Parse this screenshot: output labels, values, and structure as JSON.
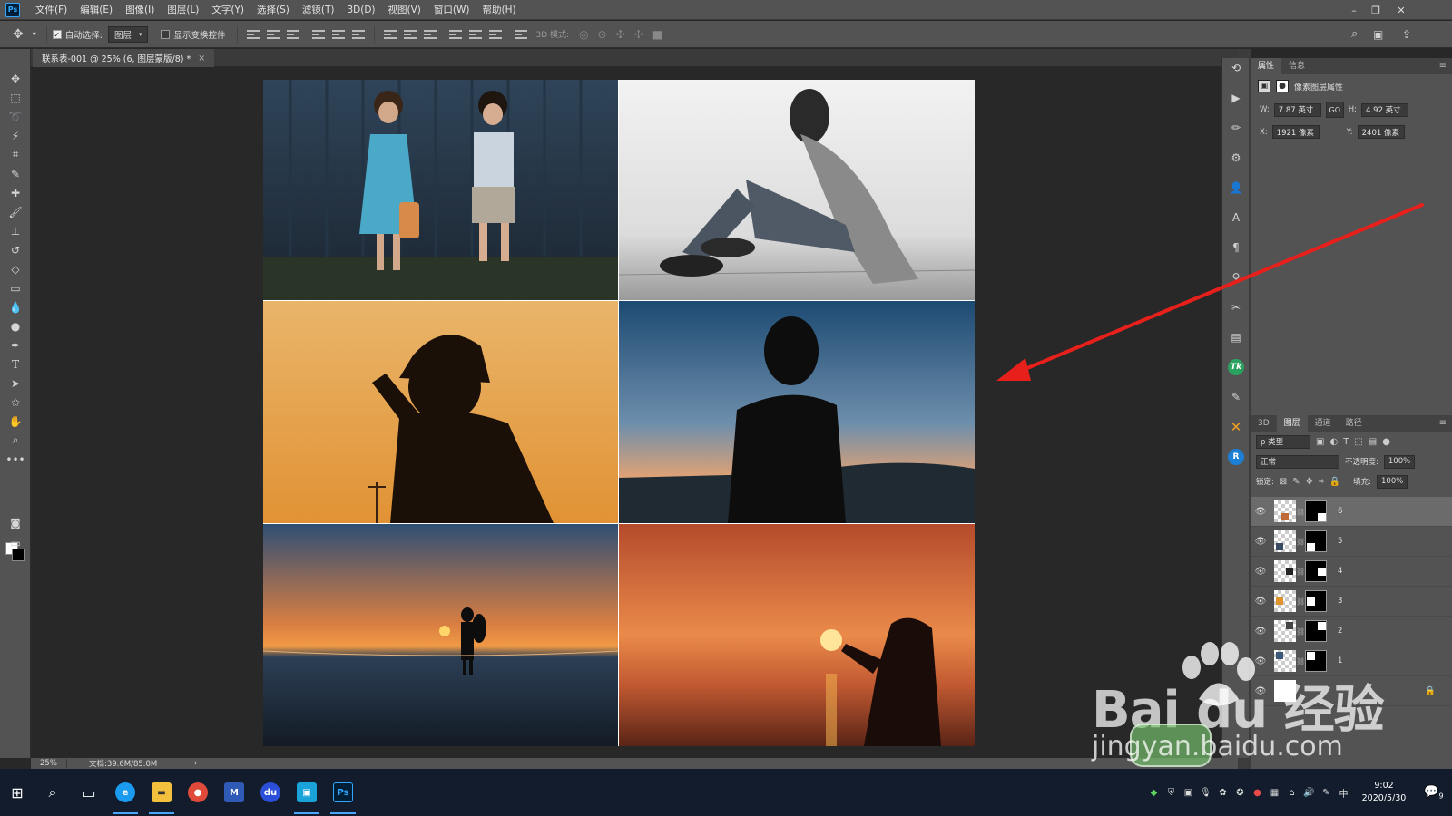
{
  "menubar": {
    "logo": "Ps",
    "items": [
      "文件(F)",
      "编辑(E)",
      "图像(I)",
      "图层(L)",
      "文字(Y)",
      "选择(S)",
      "滤镜(T)",
      "3D(D)",
      "视图(V)",
      "窗口(W)",
      "帮助(H)"
    ]
  },
  "optionsbar": {
    "auto_select_label": "自动选择:",
    "auto_select_value": "图层",
    "transform_label": "显示变换控件",
    "mode_3d_label": "3D 模式:"
  },
  "document_tab": {
    "title": "联系表-001 @ 25% (6, 图层蒙版/8) *",
    "close": "×"
  },
  "statusbar": {
    "zoom": "25%",
    "doc_info": "文档:39.6M/85.0M",
    "arrow": "›"
  },
  "properties_panel": {
    "tabs": [
      "属性",
      "信息"
    ],
    "title": "像素图层属性",
    "w_label": "W:",
    "w_value": "7.87 英寸",
    "link_label": "GO",
    "h_label": "H:",
    "h_value": "4.92 英寸",
    "x_label": "X:",
    "x_value": "1921 像素",
    "y_label": "Y:",
    "y_value": "2401 像素"
  },
  "layers_panel": {
    "tabs": [
      "3D",
      "图层",
      "通道",
      "路径"
    ],
    "filter_value": "ρ 类型",
    "blend_mode": "正常",
    "opacity_label": "不透明度:",
    "opacity_value": "100%",
    "lock_label": "锁定:",
    "fill_label": "填充:",
    "fill_value": "100%",
    "layers": [
      {
        "name": "6",
        "selected": true
      },
      {
        "name": "5",
        "selected": false
      },
      {
        "name": "4",
        "selected": false
      },
      {
        "name": "3",
        "selected": false
      },
      {
        "name": "2",
        "selected": false
      },
      {
        "name": "1",
        "selected": false
      }
    ]
  },
  "watermark": {
    "brand": "Bai du 经验",
    "url": "jingyan.baidu.com"
  },
  "taskbar": {
    "time": "9:02",
    "date": "2020/5/30",
    "ime": "中",
    "notification_count": "9"
  },
  "colors": {
    "ui_panel": "#535353",
    "canvas_bg": "#282828",
    "arrow": "#e8201c",
    "taskbar": "#121c2c"
  }
}
